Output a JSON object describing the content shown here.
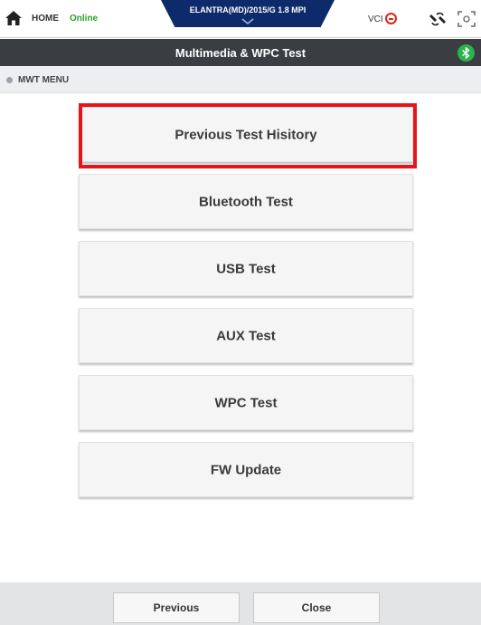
{
  "header": {
    "home_label": "HOME",
    "connection_status": "Online",
    "vehicle": "ELANTRA(MD)/2015/G 1.8 MPI",
    "vci_label": "VCI",
    "colors": {
      "online": "#2ca02c",
      "vehicle_tab": "#0d2a6a",
      "vci_error": "#e0231b"
    },
    "icons": [
      "home-icon",
      "chevron-down-icon",
      "vci-disconnected-icon",
      "vci-connect-icon",
      "screen-capture-icon"
    ]
  },
  "titlebar": {
    "title": "Multimedia & WPC Test",
    "bluetooth_icon": "bluetooth-icon",
    "colors": {
      "background": "#3a3d42",
      "bluetooth_badge": "#2bb24c"
    }
  },
  "menu": {
    "header": "MWT MENU",
    "items": [
      {
        "label": "Previous Test Hisitory",
        "selected": true
      },
      {
        "label": "Bluetooth Test",
        "selected": false
      },
      {
        "label": "USB Test",
        "selected": false
      },
      {
        "label": "AUX Test",
        "selected": false
      },
      {
        "label": "WPC Test",
        "selected": false
      },
      {
        "label": "FW Update",
        "selected": false
      }
    ],
    "highlight_color": "#e8141c"
  },
  "footer": {
    "previous_label": "Previous",
    "close_label": "Close"
  }
}
